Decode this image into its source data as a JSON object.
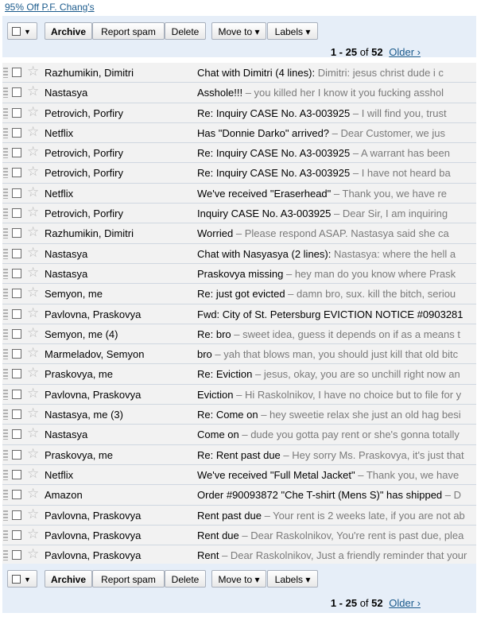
{
  "ad_link": "95% Off P.F. Chang's",
  "toolbar": {
    "archive": "Archive",
    "report_spam": "Report spam",
    "delete": "Delete",
    "move_to": "Move to ▾",
    "labels": "Labels ▾"
  },
  "pager": {
    "range": "1 - 25",
    "of": "of",
    "total": "52",
    "older": "Older ›"
  },
  "messages": [
    {
      "sender": "Razhumikin,  Dimitri",
      "subject": "Chat with Dimitri (4 lines):",
      "snippet": " Dimitri: jesus christ dude i c"
    },
    {
      "sender": "Nastasya",
      "subject": "Asshole!!!",
      "snippet": " – you killed her I know it you fucking asshol"
    },
    {
      "sender": "Petrovich, Porfiry",
      "subject": "Re: Inquiry CASE No. A3-003925",
      "snippet": " – I will find you, trust"
    },
    {
      "sender": "Netflix",
      "subject": "Has \"Donnie Darko\" arrived?",
      "snippet": " – Dear Customer, we jus"
    },
    {
      "sender": "Petrovich, Porfiry",
      "subject": "Re: Inquiry CASE No. A3-003925",
      "snippet": " – A warrant  has been"
    },
    {
      "sender": "Petrovich, Porfiry",
      "subject": "Re: Inquiry CASE No. A3-003925",
      "snippet": " – I have not heard ba"
    },
    {
      "sender": "Netflix",
      "subject": "We've received \"Eraserhead\"",
      "snippet": " – Thank  you, we have re"
    },
    {
      "sender": "Petrovich, Porfiry",
      "subject": "Inquiry CASE No. A3-003925",
      "snippet": " – Dear Sir, I am inquiring"
    },
    {
      "sender": "Razhumikin,  Dimitri",
      "subject": "Worried",
      "snippet": " – Please respond ASAP. Nastasya said she ca"
    },
    {
      "sender": "Nastasya",
      "subject": "Chat with Nasyasya (2 lines):",
      "snippet": " Nastasya: where  the hell a"
    },
    {
      "sender": "Nastasya",
      "subject": "Praskovya missing",
      "snippet": " – hey man  do you know where  Prask"
    },
    {
      "sender": "Semyon, me",
      "subject": "Re: just got evicted",
      "snippet": " – damn bro, sux. kill the bitch, seriou"
    },
    {
      "sender": "Pavlovna, Praskovya",
      "subject": "Fwd: City of St. Petersburg EVICTION  NOTICE  #0903281",
      "snippet": ""
    },
    {
      "sender": "Semyon, me (4)",
      "subject": "Re: bro",
      "snippet": " – sweet idea, guess it depends on if as a means t"
    },
    {
      "sender": "Marmeladov, Semyon",
      "subject": "bro",
      "snippet": " – yah that blows man, you should just kill that old bitc"
    },
    {
      "sender": "Praskovya, me",
      "subject": "Re: Eviction",
      "snippet": " – jesus, okay, you are so unchill right now an"
    },
    {
      "sender": "Pavlovna, Praskovya",
      "subject": "Eviction",
      "snippet": " – Hi Raskolnikov, I have no choice but to file for y"
    },
    {
      "sender": "Nastasya, me (3)",
      "subject": "Re: Come  on",
      "snippet": " – hey sweetie relax she just an old hag besi"
    },
    {
      "sender": "Nastasya",
      "subject": "Come on",
      "snippet": " – dude you gotta pay rent or she's gonna totally"
    },
    {
      "sender": "Praskovya, me",
      "subject": "Re: Rent past due",
      "snippet": " – Hey sorry Ms. Praskovya, it's just that"
    },
    {
      "sender": "Netflix",
      "subject": "We've received \"Full Metal Jacket\"",
      "snippet": " – Thank  you, we have"
    },
    {
      "sender": "Amazon",
      "subject": "Order #90093872  \"Che T-shirt  (Mens S)\" has shipped",
      "snippet": " – D"
    },
    {
      "sender": "Pavlovna, Praskovya",
      "subject": "Rent past due",
      "snippet": " – Your rent is 2 weeks late, if you are not ab"
    },
    {
      "sender": "Pavlovna, Praskovya",
      "subject": "Rent due",
      "snippet": " – Dear Raskolnikov, You're rent is past due, plea"
    },
    {
      "sender": "Pavlovna, Praskovya",
      "subject": "Rent",
      "snippet": " – Dear Raskolnikov, Just a friendly reminder that your"
    }
  ]
}
